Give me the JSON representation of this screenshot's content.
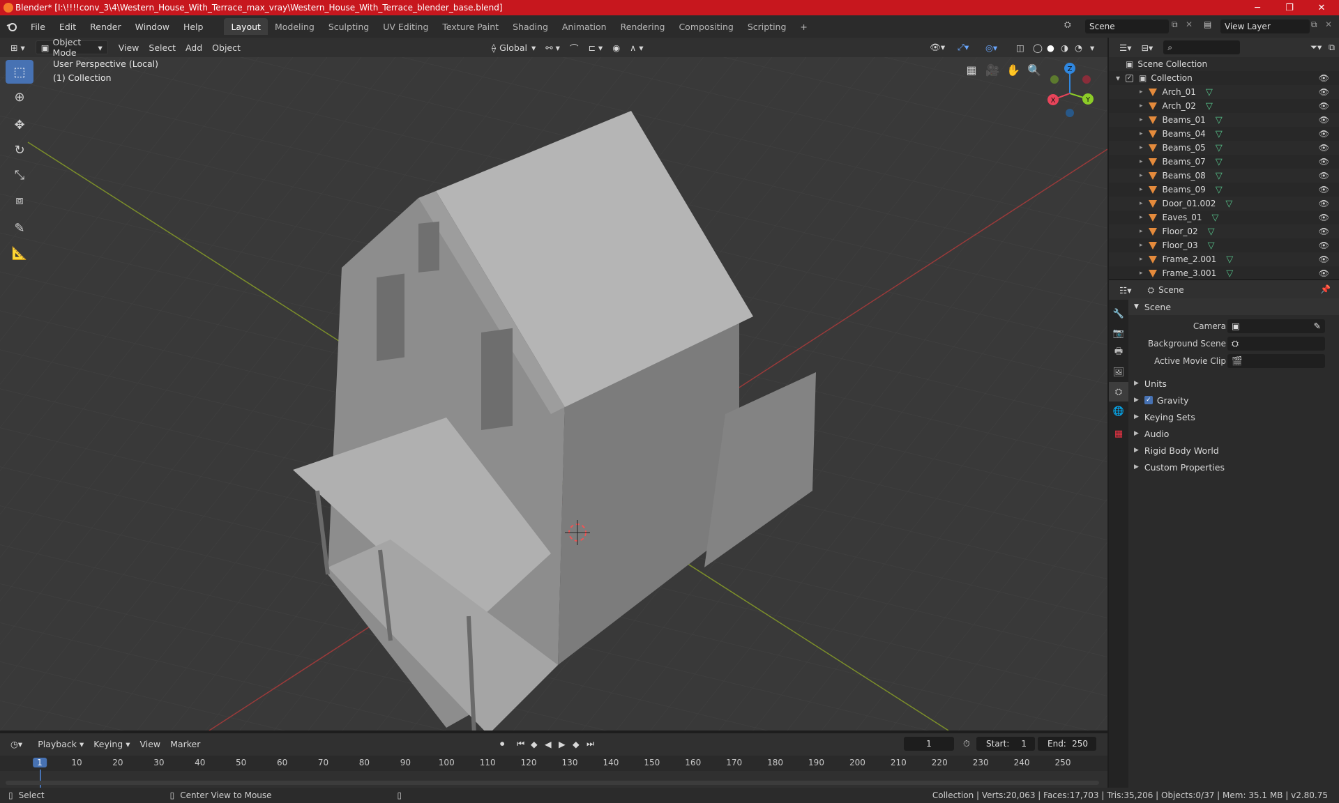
{
  "titlebar": {
    "title": "Blender* [I:\\!!!!conv_3\\4\\Western_House_With_Terrace_max_vray\\Western_House_With_Terrace_blender_base.blend]",
    "minimize": "─",
    "maximize": "❐",
    "close": "✕"
  },
  "menu": {
    "items": [
      "File",
      "Edit",
      "Render",
      "Window",
      "Help"
    ],
    "workspaces": [
      "Layout",
      "Modeling",
      "Sculpting",
      "UV Editing",
      "Texture Paint",
      "Shading",
      "Animation",
      "Rendering",
      "Compositing",
      "Scripting"
    ],
    "add_tab": "+",
    "scene": "Scene",
    "view_layer": "View Layer"
  },
  "viewport": {
    "mode": "Object Mode",
    "menus": [
      "View",
      "Select",
      "Add",
      "Object"
    ],
    "orientation": "Global",
    "info_line1": "User Perspective (Local)",
    "info_line2": "(1) Collection",
    "gizmo": {
      "x": "X",
      "y": "Y",
      "z": "Z"
    }
  },
  "outliner": {
    "search_placeholder": "",
    "scene_collection": "Scene Collection",
    "collection": "Collection",
    "objects": [
      "Arch_01",
      "Arch_02",
      "Beams_01",
      "Beams_04",
      "Beams_05",
      "Beams_07",
      "Beams_08",
      "Beams_09",
      "Door_01.002",
      "Eaves_01",
      "Floor_02",
      "Floor_03",
      "Frame_2.001",
      "Frame_3.001"
    ]
  },
  "properties": {
    "context": "Scene",
    "panel": "Scene",
    "fields": [
      {
        "label": "Camera"
      },
      {
        "label": "Background Scene"
      },
      {
        "label": "Active Movie Clip"
      }
    ],
    "subpanels": [
      "Units",
      "Gravity",
      "Keying Sets",
      "Audio",
      "Rigid Body World",
      "Custom Properties"
    ]
  },
  "timeline": {
    "menus": [
      "Playback",
      "Keying",
      "View",
      "Marker"
    ],
    "current_frame": "1",
    "start_label": "Start:",
    "start": "1",
    "end_label": "End:",
    "end": "250",
    "ticks": [
      "1",
      "10",
      "20",
      "30",
      "40",
      "50",
      "60",
      "70",
      "80",
      "90",
      "100",
      "110",
      "120",
      "130",
      "140",
      "150",
      "160",
      "170",
      "180",
      "190",
      "200",
      "210",
      "220",
      "230",
      "240",
      "250"
    ]
  },
  "status": {
    "select": "Select",
    "center": "Center View to Mouse",
    "stats": "Collection | Verts:20,063 | Faces:17,703 | Tris:35,206 | Objects:0/37 | Mem: 35.1 MB | v2.80.75"
  },
  "colors": {
    "titlebar": "#c7171e",
    "accent": "#4772b3",
    "object": "#e58b3c",
    "mesh": "#56c28a",
    "axis_x": "#e8445a",
    "axis_y": "#8ccc28",
    "axis_z": "#2f87e0"
  }
}
